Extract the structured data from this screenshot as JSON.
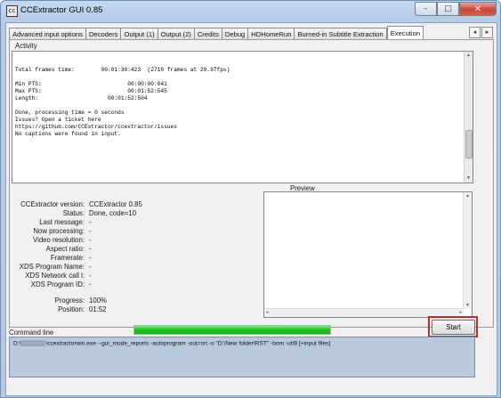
{
  "window": {
    "title": "CCExtractor GUI 0.85",
    "icon": "cc-icon"
  },
  "caption_buttons": {
    "minimize": "–",
    "maximize": "□",
    "close": "✕"
  },
  "tabs": [
    {
      "label": "Advanced input options",
      "active": false
    },
    {
      "label": "Decoders",
      "active": false
    },
    {
      "label": "Output (1)",
      "active": false
    },
    {
      "label": "Output (2)",
      "active": false
    },
    {
      "label": "Credits",
      "active": false
    },
    {
      "label": "Debug",
      "active": false
    },
    {
      "label": "HDHomeRun",
      "active": false
    },
    {
      "label": "Burned-in Subtitle Extraction",
      "active": false
    },
    {
      "label": "Execution",
      "active": true
    }
  ],
  "tab_scroll": {
    "left": "◂",
    "right": "▸"
  },
  "activity": {
    "label": "Activity",
    "lines": [
      "Total frames time:        00:01:30:423  (2710 frames at 29.97fps)",
      "",
      "Min PTS:                          00:00:00:041",
      "Max PTS:                          00:01:52:545",
      "Length:                     00:01:52:504",
      "",
      "Done, processing time = 0 seconds",
      "Issues? Open a ticket here",
      "https://github.com/CCExtractor/ccextractor/issues",
      "No captions were found in input."
    ]
  },
  "status": [
    {
      "label": "CCExtractor version:",
      "value": "CCExtractor 0.85"
    },
    {
      "label": "Status:",
      "value": "Done, code=10"
    },
    {
      "label": "Last message:",
      "value": "-"
    },
    {
      "label": "Now processing:",
      "value": "-"
    },
    {
      "label": "Video resolution:",
      "value": "-"
    },
    {
      "label": "Aspect ratio:",
      "value": "-"
    },
    {
      "label": "Framerate:",
      "value": "-"
    },
    {
      "label": "XDS Program Name:",
      "value": "-"
    },
    {
      "label": "XDS Network call l:",
      "value": "-"
    },
    {
      "label": "XDS Program ID:",
      "value": "-"
    },
    {
      "label": "Progress:",
      "value": "100%"
    },
    {
      "label": "Position:",
      "value": "01:52"
    }
  ],
  "preview": {
    "label": "Preview"
  },
  "start_button": {
    "label": "Start"
  },
  "progress": {
    "fraction": 1.0,
    "color": "#22c522"
  },
  "command_line": {
    "label": "Command line",
    "prefix": "D:\\",
    "text": "\\ccextractorwin.exe  --gui_mode_reports  -autoprogram  -out=srt -o \"D:\\New folder\\RST\" -bom -utf8 [+input files]"
  },
  "colors": {
    "highlight": "#c7272d",
    "window_frame": "#b6cce6"
  }
}
